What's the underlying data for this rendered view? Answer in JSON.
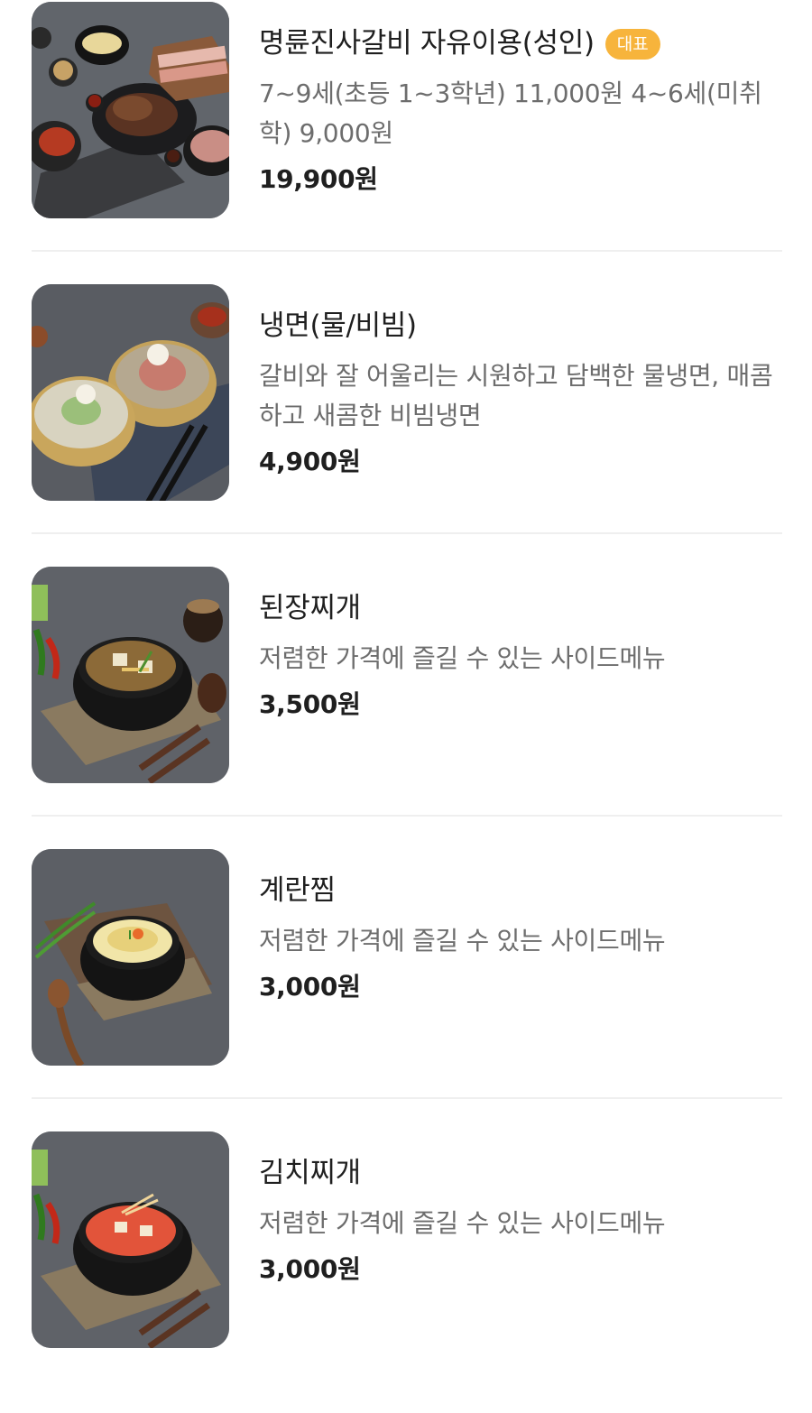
{
  "menu": {
    "items": [
      {
        "name": "명륜진사갈비 자유이용(성인)",
        "badge": "대표",
        "description": "7~9세(초등 1~3학년) 11,000원 4~6세(미취학) 9,000원",
        "price": "19,900원",
        "image": "galbi-platter-photo"
      },
      {
        "name": "냉면(물/비빔)",
        "badge": "",
        "description": "갈비와 잘 어울리는 시원하고 담백한 물냉면, 매콤하고 새콤한 비빔냉면",
        "price": "4,900원",
        "image": "naengmyeon-photo"
      },
      {
        "name": "된장찌개",
        "badge": "",
        "description": "저렴한 가격에 즐길 수 있는 사이드메뉴",
        "price": "3,500원",
        "image": "doenjang-jjigae-photo"
      },
      {
        "name": "계란찜",
        "badge": "",
        "description": "저렴한 가격에 즐길 수 있는 사이드메뉴",
        "price": "3,000원",
        "image": "gyeran-jjim-photo"
      },
      {
        "name": "김치찌개",
        "badge": "",
        "description": "저렴한 가격에 즐길 수 있는 사이드메뉴",
        "price": "3,000원",
        "image": "kimchi-jjigae-photo"
      }
    ]
  },
  "colors": {
    "badge_bg": "#f7b43c",
    "text_primary": "#1f1f1f",
    "text_secondary": "#6d6d6d",
    "divider": "#efefef"
  }
}
